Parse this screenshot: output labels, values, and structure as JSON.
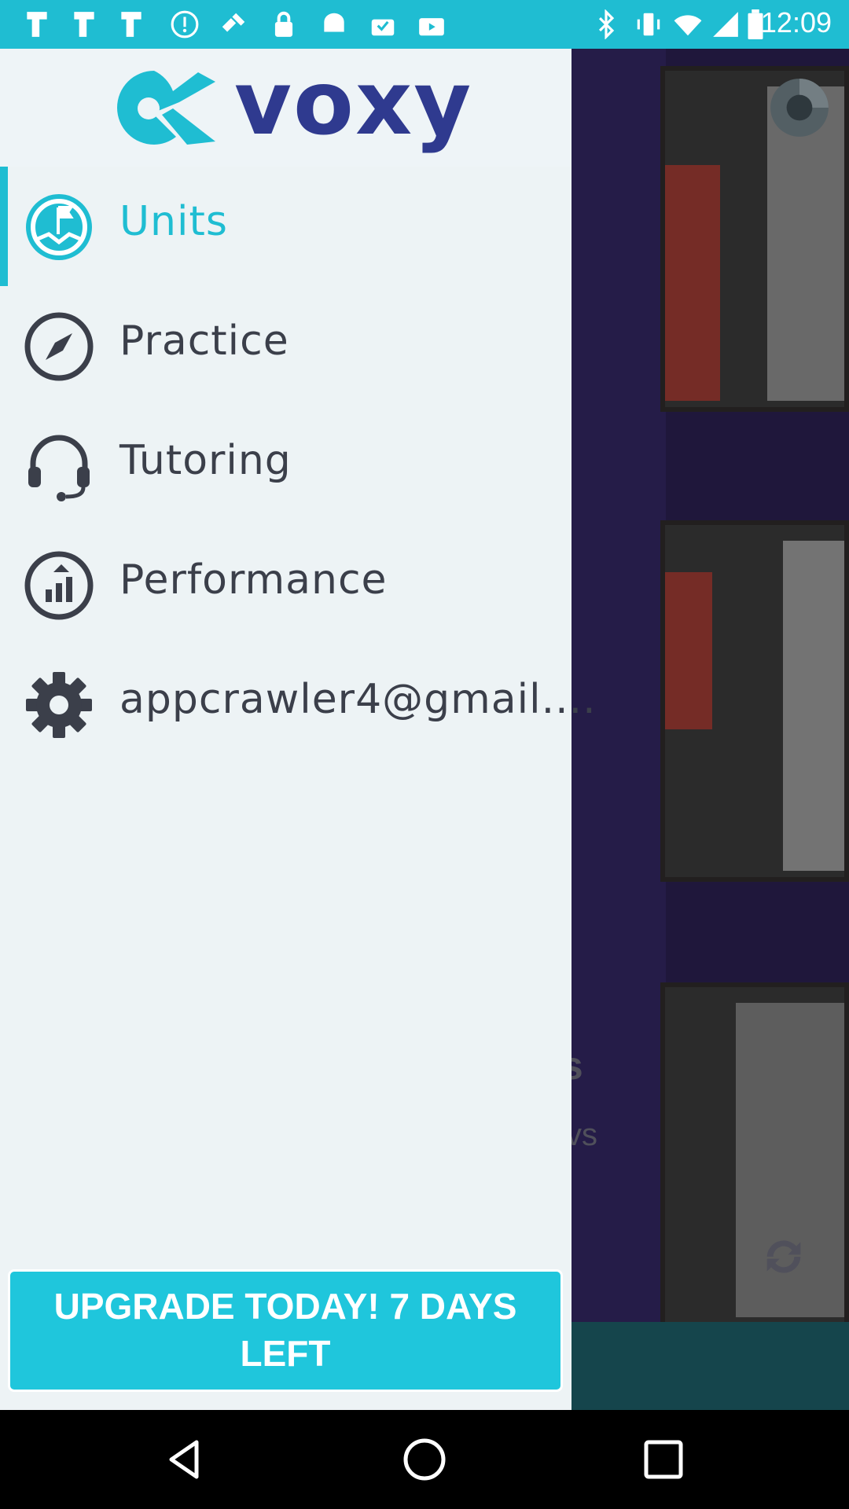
{
  "status_bar": {
    "time": "12:09",
    "icons": [
      "fake-gps-icon",
      "fake-gps-icon",
      "fake-gps-icon",
      "sync-icon",
      "satellite-icon",
      "lock-icon",
      "android-icon",
      "task-icon",
      "briefcase-icon",
      "bluetooth-icon",
      "vibrate-icon",
      "wifi-icon",
      "signal-icon",
      "battery-icon"
    ]
  },
  "background_app": {
    "caption_1": "ls",
    "caption_2": "vs"
  },
  "drawer": {
    "logo_text": "voxy",
    "items": [
      {
        "label": "Units",
        "icon": "flag-mountain-icon",
        "active": true
      },
      {
        "label": "Practice",
        "icon": "compass-icon",
        "active": false
      },
      {
        "label": "Tutoring",
        "icon": "headset-icon",
        "active": false
      },
      {
        "label": "Performance",
        "icon": "bar-chart-icon",
        "active": false
      },
      {
        "label": "appcrawler4@gmail....",
        "icon": "gear-icon",
        "active": false
      }
    ],
    "upgrade_label": "UPGRADE TODAY! 7 DAYS LEFT"
  },
  "colors": {
    "accent": "#1fbdd2",
    "logo": "#2f3a8f",
    "drawer_bg": "#edf3f5",
    "text": "#3b3f4a"
  },
  "system_nav": [
    "back-icon",
    "home-icon",
    "recents-icon"
  ]
}
